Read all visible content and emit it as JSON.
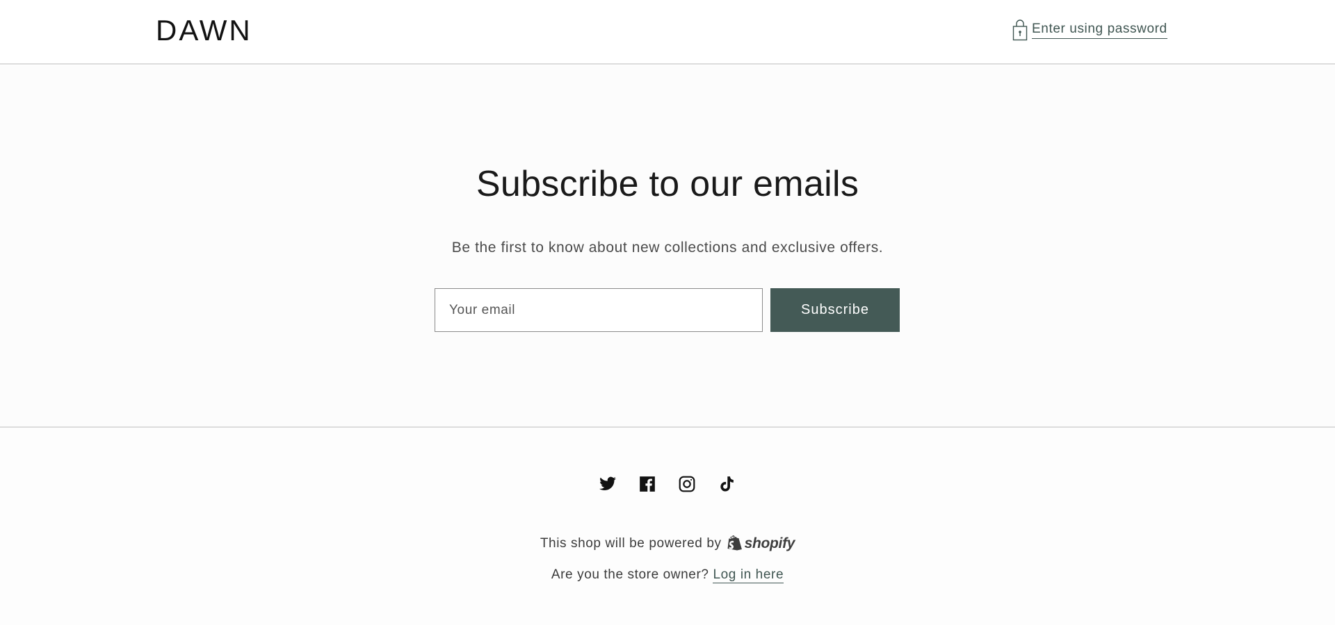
{
  "header": {
    "logo": "DAWN",
    "password_link": "Enter using password",
    "password_icon": "lock-icon"
  },
  "newsletter": {
    "title": "Subscribe to our emails",
    "subtitle": "Be the first to know about new collections and exclusive offers.",
    "email_placeholder": "Your email",
    "email_value": "",
    "subscribe_label": "Subscribe",
    "button_color": "#445a56"
  },
  "footer": {
    "social_icons": [
      "twitter-icon",
      "facebook-icon",
      "instagram-icon",
      "tiktok-icon"
    ],
    "powered_text": "This shop will be powered by",
    "shopify_word": "shopify",
    "owner_text": "Are you the store owner?",
    "login_link": "Log in here"
  },
  "colors": {
    "accent": "#3f5551",
    "text": "#121212",
    "divider": "#dcdcdc"
  }
}
